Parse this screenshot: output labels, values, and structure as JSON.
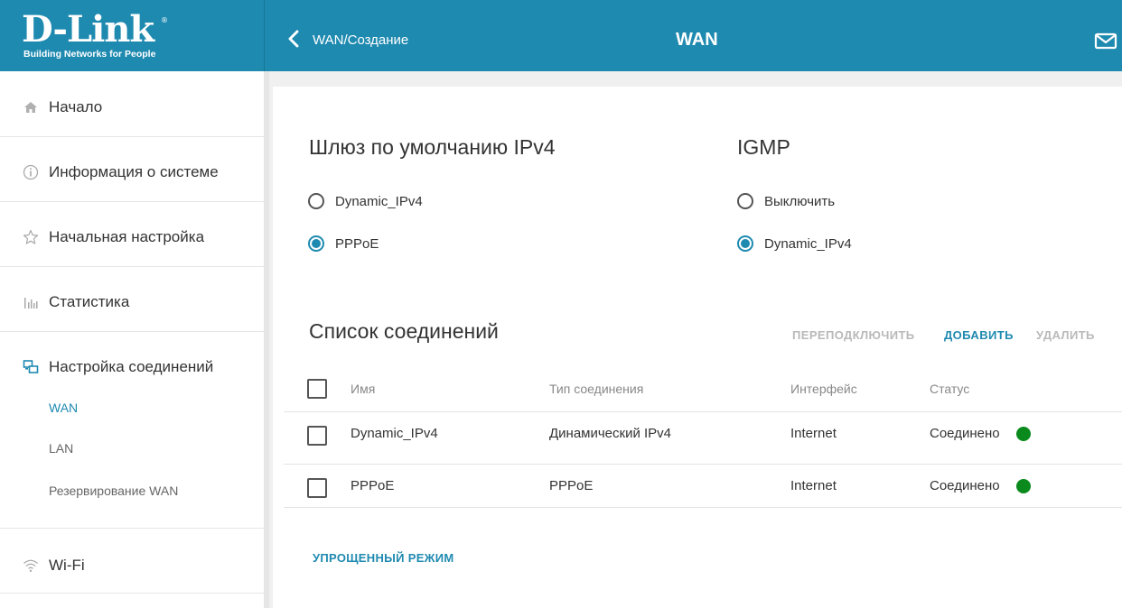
{
  "brand": {
    "logo_text": "D-Link",
    "logo_tagline": "Building Networks for People",
    "registered_mark": "®"
  },
  "header": {
    "breadcrumb": "WAN/Создание",
    "title": "WAN",
    "back_icon": "chevron-left-icon",
    "mail_icon": "mail-icon",
    "color": "#1f8ab0"
  },
  "sidebar": {
    "items": [
      {
        "label": "Начало",
        "icon": "home-icon"
      },
      {
        "label": "Информация о системе",
        "icon": "info-icon"
      },
      {
        "label": "Начальная настройка",
        "icon": "star-icon"
      },
      {
        "label": "Статистика",
        "icon": "stats-icon"
      },
      {
        "label": "Настройка соединений",
        "icon": "connections-icon",
        "sub_items": [
          {
            "label": "WAN",
            "active": true
          },
          {
            "label": "LAN",
            "active": false
          },
          {
            "label": "Резервирование WAN",
            "active": false
          }
        ]
      },
      {
        "label": "Wi-Fi",
        "icon": "wifi-icon"
      }
    ]
  },
  "gateway": {
    "title": "Шлюз по умолчанию IPv4",
    "options": [
      {
        "label": "Dynamic_IPv4",
        "checked": false
      },
      {
        "label": "PPPoE",
        "checked": true
      }
    ]
  },
  "igmp": {
    "title": "IGMP",
    "options": [
      {
        "label": "Выключить",
        "checked": false
      },
      {
        "label": "Dynamic_IPv4",
        "checked": true
      }
    ]
  },
  "connections": {
    "title": "Список соединений",
    "actions": {
      "reconnect": "ПЕРЕПОДКЛЮЧИТЬ",
      "add": "ДОБАВИТЬ",
      "delete": "УДАЛИТЬ"
    },
    "columns": [
      "Имя",
      "Тип соединения",
      "Интерфейс",
      "Статус"
    ],
    "rows": [
      {
        "name": "Dynamic_IPv4",
        "type": "Динамический IPv4",
        "interface": "Internet",
        "status": "Соединено",
        "status_color": "#0a8a1c"
      },
      {
        "name": "PPPoE",
        "type": "PPPoE",
        "interface": "Internet",
        "status": "Соединено",
        "status_color": "#0a8a1c"
      }
    ]
  },
  "footer": {
    "simple_mode": "УПРОЩЕННЫЙ РЕЖИМ"
  }
}
